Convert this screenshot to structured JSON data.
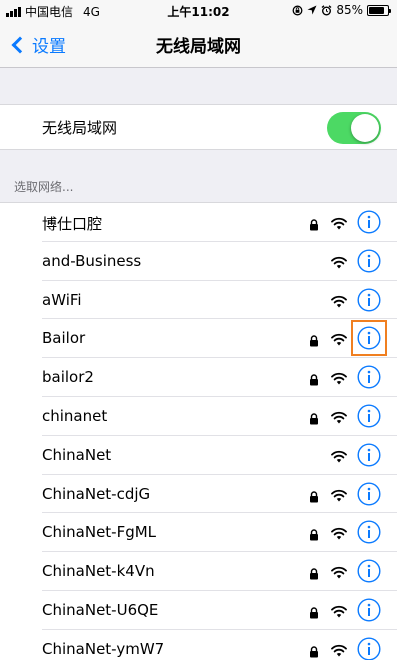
{
  "status_bar": {
    "carrier": "中国电信",
    "network": "4G",
    "time": "上午11:02",
    "battery_percent": "85%",
    "battery_level": 0.85
  },
  "nav": {
    "back_label": "设置",
    "title": "无线局域网"
  },
  "wifi_toggle": {
    "label": "无线局域网",
    "on": true
  },
  "networks_header": "选取网络...",
  "networks": [
    {
      "name": "博仕口腔",
      "locked": true
    },
    {
      "name": "and-Business",
      "locked": false
    },
    {
      "name": "aWiFi",
      "locked": false
    },
    {
      "name": "Bailor",
      "locked": true,
      "highlighted": true
    },
    {
      "name": "bailor2",
      "locked": true
    },
    {
      "name": "chinanet",
      "locked": true
    },
    {
      "name": "ChinaNet",
      "locked": false
    },
    {
      "name": "ChinaNet-cdjG",
      "locked": true
    },
    {
      "name": "ChinaNet-FgML",
      "locked": true
    },
    {
      "name": "ChinaNet-k4Vn",
      "locked": true
    },
    {
      "name": "ChinaNet-U6QE",
      "locked": true
    },
    {
      "name": "ChinaNet-ymW7",
      "locked": true
    }
  ],
  "colors": {
    "accent": "#0a7aff",
    "toggle_on": "#4cd964",
    "highlight": "#f07f20"
  }
}
